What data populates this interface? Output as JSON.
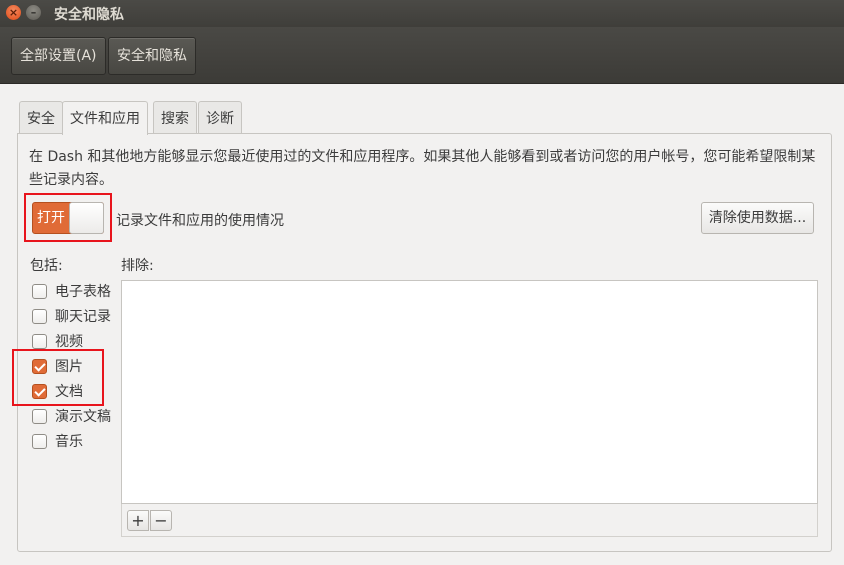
{
  "window": {
    "title": "安全和隐私",
    "close_glyph": "×",
    "min_glyph": "–"
  },
  "toolbar": {
    "all_settings": "全部设置(A)",
    "current": "安全和隐私"
  },
  "tabs": [
    "安全",
    "文件和应用",
    "搜索",
    "诊断"
  ],
  "active_tab": "文件和应用",
  "files_apps": {
    "description": "在 Dash 和其他地方能够显示您最近使用过的文件和应用程序。如果其他人能够看到或者访问您的用户帐号，您可能希望限制某些记录内容。",
    "switch_label": "打开",
    "switch_on": true,
    "switch_caption": "记录文件和应用的使用情况",
    "clear_button": "清除使用数据...",
    "include_label": "包括:",
    "exclude_label": "排除:",
    "include_items": [
      {
        "label": "电子表格",
        "checked": false
      },
      {
        "label": "聊天记录",
        "checked": false
      },
      {
        "label": "视频",
        "checked": false
      },
      {
        "label": "图片",
        "checked": true
      },
      {
        "label": "文档",
        "checked": true
      },
      {
        "label": "演示文稿",
        "checked": false
      },
      {
        "label": "音乐",
        "checked": false
      }
    ],
    "add_glyph": "+",
    "remove_glyph": "−"
  },
  "colors": {
    "accent": "#e06b37",
    "highlight": "#e8141c",
    "titlebar": "#3f3e3a"
  }
}
